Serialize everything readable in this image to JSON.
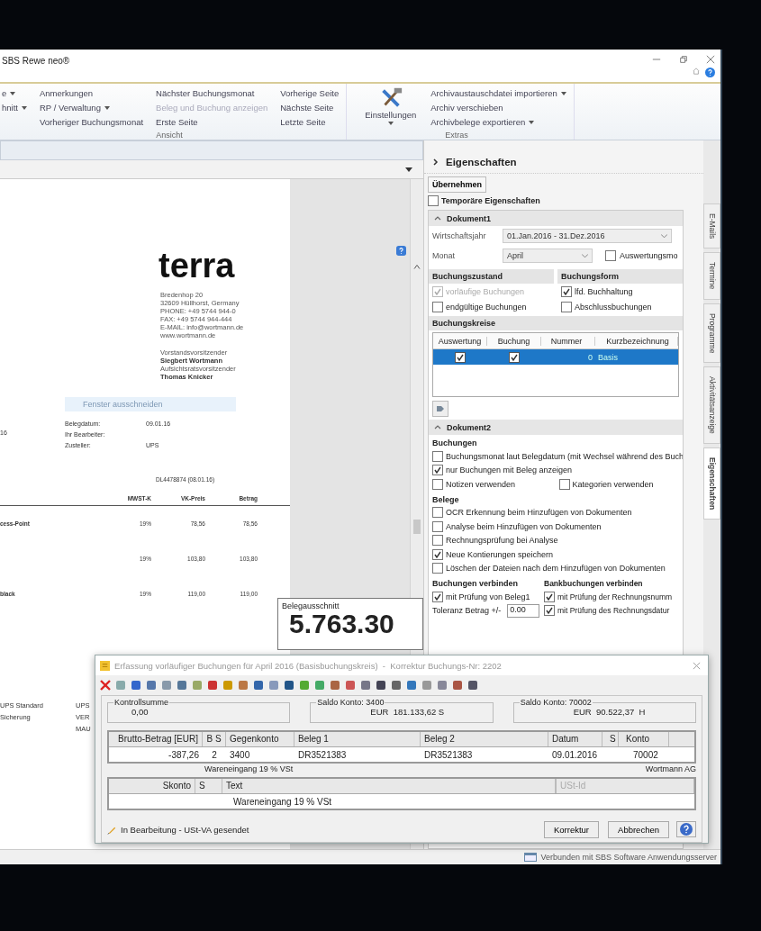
{
  "window": {
    "title": "SBS Rewe neo®"
  },
  "ribbon": {
    "sections": [
      {
        "label": "Ansicht",
        "columns": [
          [
            {
              "label": "e",
              "dropdown": true,
              "disabled": false
            },
            {
              "label": "hnitt",
              "dropdown": true,
              "disabled": false
            }
          ],
          [
            {
              "label": "Anmerkungen",
              "dropdown": false,
              "disabled": false
            },
            {
              "label": "RP / Verwaltung",
              "dropdown": true,
              "disabled": false
            },
            {
              "label": "Vorheriger Buchungsmonat",
              "dropdown": false,
              "disabled": false
            }
          ],
          [
            {
              "label": "Nächster Buchungsmonat",
              "dropdown": false,
              "disabled": false
            },
            {
              "label": "Beleg und Buchung anzeigen",
              "dropdown": false,
              "disabled": true
            },
            {
              "label": "Erste Seite",
              "dropdown": false,
              "disabled": false
            }
          ],
          [
            {
              "label": "Vorherige Seite",
              "dropdown": false,
              "disabled": false
            },
            {
              "label": "Nächste Seite",
              "dropdown": false,
              "disabled": false
            },
            {
              "label": "Letzte Seite",
              "dropdown": false,
              "disabled": false
            }
          ]
        ]
      },
      {
        "label": "Extras",
        "large_button": {
          "label": "Einstellungen"
        },
        "columns": [
          [
            {
              "label": "Archivaustauschdatei importieren",
              "dropdown": true,
              "disabled": false
            },
            {
              "label": "Archiv verschieben",
              "dropdown": false,
              "disabled": false
            },
            {
              "label": "Archivbelege exportieren",
              "dropdown": true,
              "disabled": false
            }
          ]
        ]
      }
    ]
  },
  "document": {
    "invoice": {
      "logo": "terra",
      "address": [
        "Bredenhop 20",
        "32609 Hüllhorst, Germany",
        "PHONE: +49 5744 944-0",
        "FAX: +49 5744 944-444",
        "E-MAIL: info@wortmann.de",
        "www.wortmann.de"
      ],
      "board": [
        {
          "text": "Vorstandsvorsitzender",
          "bold": false
        },
        {
          "text": "Siegbert Wortmann",
          "bold": true
        },
        {
          "text": "Aufsichtsratsvorsitzender",
          "bold": false
        },
        {
          "text": "Thomas Knicker",
          "bold": true
        }
      ],
      "faded_hint": "Fenster ausschneiden",
      "left_fragment": "16",
      "meta": [
        {
          "label": "Belegdatum:",
          "value": "09.01.16"
        },
        {
          "label": "Ihr Bearbeiter:"
        },
        {
          "label": "Zusteller:",
          "value": "UPS"
        }
      ],
      "reference": "DL4478874 (08.01.16)",
      "columns": [
        "MWST-K",
        "VK-Preis",
        "Betrag"
      ],
      "rows": [
        {
          "description": "cess-Point",
          "tax": "19%",
          "price": "78,56",
          "amount": "78,56"
        },
        {
          "tax": "19%",
          "price": "103,80",
          "amount": "103,80"
        },
        {
          "description": "black",
          "tax": "19%",
          "price": "119,00",
          "amount": "119,00"
        }
      ],
      "shipping": [
        {
          "left": "UPS Standard",
          "right": "UPS"
        },
        {
          "left": "Sicherung",
          "right": "VER"
        },
        {
          "right": "MAU"
        }
      ]
    },
    "excerpt": {
      "label": "Belegausschnitt",
      "amount": "5.763.30"
    }
  },
  "properties": {
    "title": "Eigenschaften",
    "apply_button": "Übernehmen",
    "temporary": {
      "label": "Temporäre Eigenschaften",
      "checked": false
    },
    "document1": {
      "title": "Dokument1",
      "expanded": true,
      "fields": [
        {
          "label": "Wirtschaftsjahr",
          "value": "01.Jan.2016 - 31.Dez.2016"
        },
        {
          "label": "Monat",
          "value": "April"
        }
      ],
      "month_check": {
        "label": "Auswertungsmo",
        "checked": false
      },
      "groups": [
        {
          "title": "Buchungszustand",
          "options": [
            {
              "label": "vorläufige Buchungen",
              "checked": true,
              "disabled": true
            },
            {
              "label": "endgültige Buchungen",
              "checked": false,
              "disabled": false
            }
          ]
        },
        {
          "title": "Buchungsform",
          "options": [
            {
              "label": "lfd. Buchhaltung",
              "checked": true,
              "disabled": false
            },
            {
              "label": "Abschlussbuchungen",
              "checked": false,
              "disabled": false
            }
          ]
        }
      ],
      "circles": {
        "title": "Buchungskreise",
        "columns": [
          "Auswertung",
          "Buchung",
          "Nummer",
          "Kurzbezeichnung"
        ],
        "rows": [
          {
            "evaluation": true,
            "booking": true,
            "number": "0",
            "name": "Basis",
            "selected": true
          }
        ]
      }
    },
    "document2": {
      "title": "Dokument2",
      "expanded": true,
      "sections": [
        {
          "title": "Buchungen",
          "options": [
            {
              "label": "Buchungsmonat laut Belegdatum (mit Wechsel während des Buch",
              "checked": false
            },
            {
              "label": "nur Buchungen mit Beleg anzeigen",
              "checked": true
            }
          ],
          "pair": [
            {
              "label": "Notizen verwenden",
              "checked": false
            },
            {
              "label": "Kategorien verwenden",
              "checked": false
            }
          ]
        },
        {
          "title": "Belege",
          "options": [
            {
              "label": "OCR Erkennung beim Hinzufügen von Dokumenten",
              "checked": false
            },
            {
              "label": "Analyse beim Hinzufügen von Dokumenten",
              "checked": false
            },
            {
              "label": "Rechnungsprüfung bei Analyse",
              "checked": false
            },
            {
              "label": "Neue Kontierungen speichern",
              "checked": true
            },
            {
              "label": "Löschen der Dateien nach dem Hinzufügen von Dokumenten",
              "checked": false
            }
          ]
        }
      ],
      "link_left": {
        "title": "Buchungen verbinden",
        "option": {
          "label": "mit Prüfung von Beleg1",
          "checked": true
        },
        "tolerance_label": "Toleranz Betrag +/-",
        "tolerance": "0.00"
      },
      "link_right": {
        "title": "Bankbuchungen verbinden",
        "options": [
          {
            "label": "mit Prüfung der Rechnungsnumm",
            "checked": true
          },
          {
            "label": "mit Prüfung des Rechnungsdatur",
            "checked": true
          }
        ]
      }
    }
  },
  "side_tabs": [
    {
      "label": "E-Mails",
      "selected": false
    },
    {
      "label": "Termine",
      "selected": false
    },
    {
      "label": "Programme",
      "selected": false
    },
    {
      "label": "Aktivitätsanzeige",
      "selected": false
    },
    {
      "label": "Eigenschaften",
      "selected": true
    }
  ],
  "dialog": {
    "title": "Erfassung vorläufiger Buchungen für April 2016 (Basisbuchungskreis)  -  Korrektur Buchungs-Nr: 2202",
    "summaries": [
      {
        "label": "Kontrollsumme",
        "value": "0,00"
      },
      {
        "label": "Saldo Konto: 3400",
        "value": "EUR  181.133,62 S"
      },
      {
        "label": "Saldo Konto: 70002",
        "value": "EUR  90.522,37  H"
      }
    ],
    "table": {
      "columns": [
        "Brutto-Betrag [EUR]",
        "B S",
        "Gegenkonto",
        "Beleg 1",
        "Beleg 2",
        "Datum",
        "S",
        "Konto"
      ],
      "row": {
        "amount": "-387,26",
        "bs": "2",
        "counter_account": "3400",
        "receipt1": "DR3521383",
        "receipt2": "DR3521383",
        "date": "09.01.2016",
        "account": "70002"
      }
    },
    "account_text": "Wareneingang 19 % VSt",
    "partner": "Wortmann AG",
    "table2": {
      "columns": [
        "Skonto",
        "S",
        "Text"
      ],
      "vat_id_placeholder": "USt-Id",
      "text": "Wareneingang 19 % VSt"
    },
    "status": "In Bearbeitung - USt-VA gesendet",
    "buttons": [
      "Korrektur",
      "Abbrechen"
    ]
  },
  "status_bar": {
    "text": "Verbunden mit SBS Software Anwendungsserver"
  }
}
